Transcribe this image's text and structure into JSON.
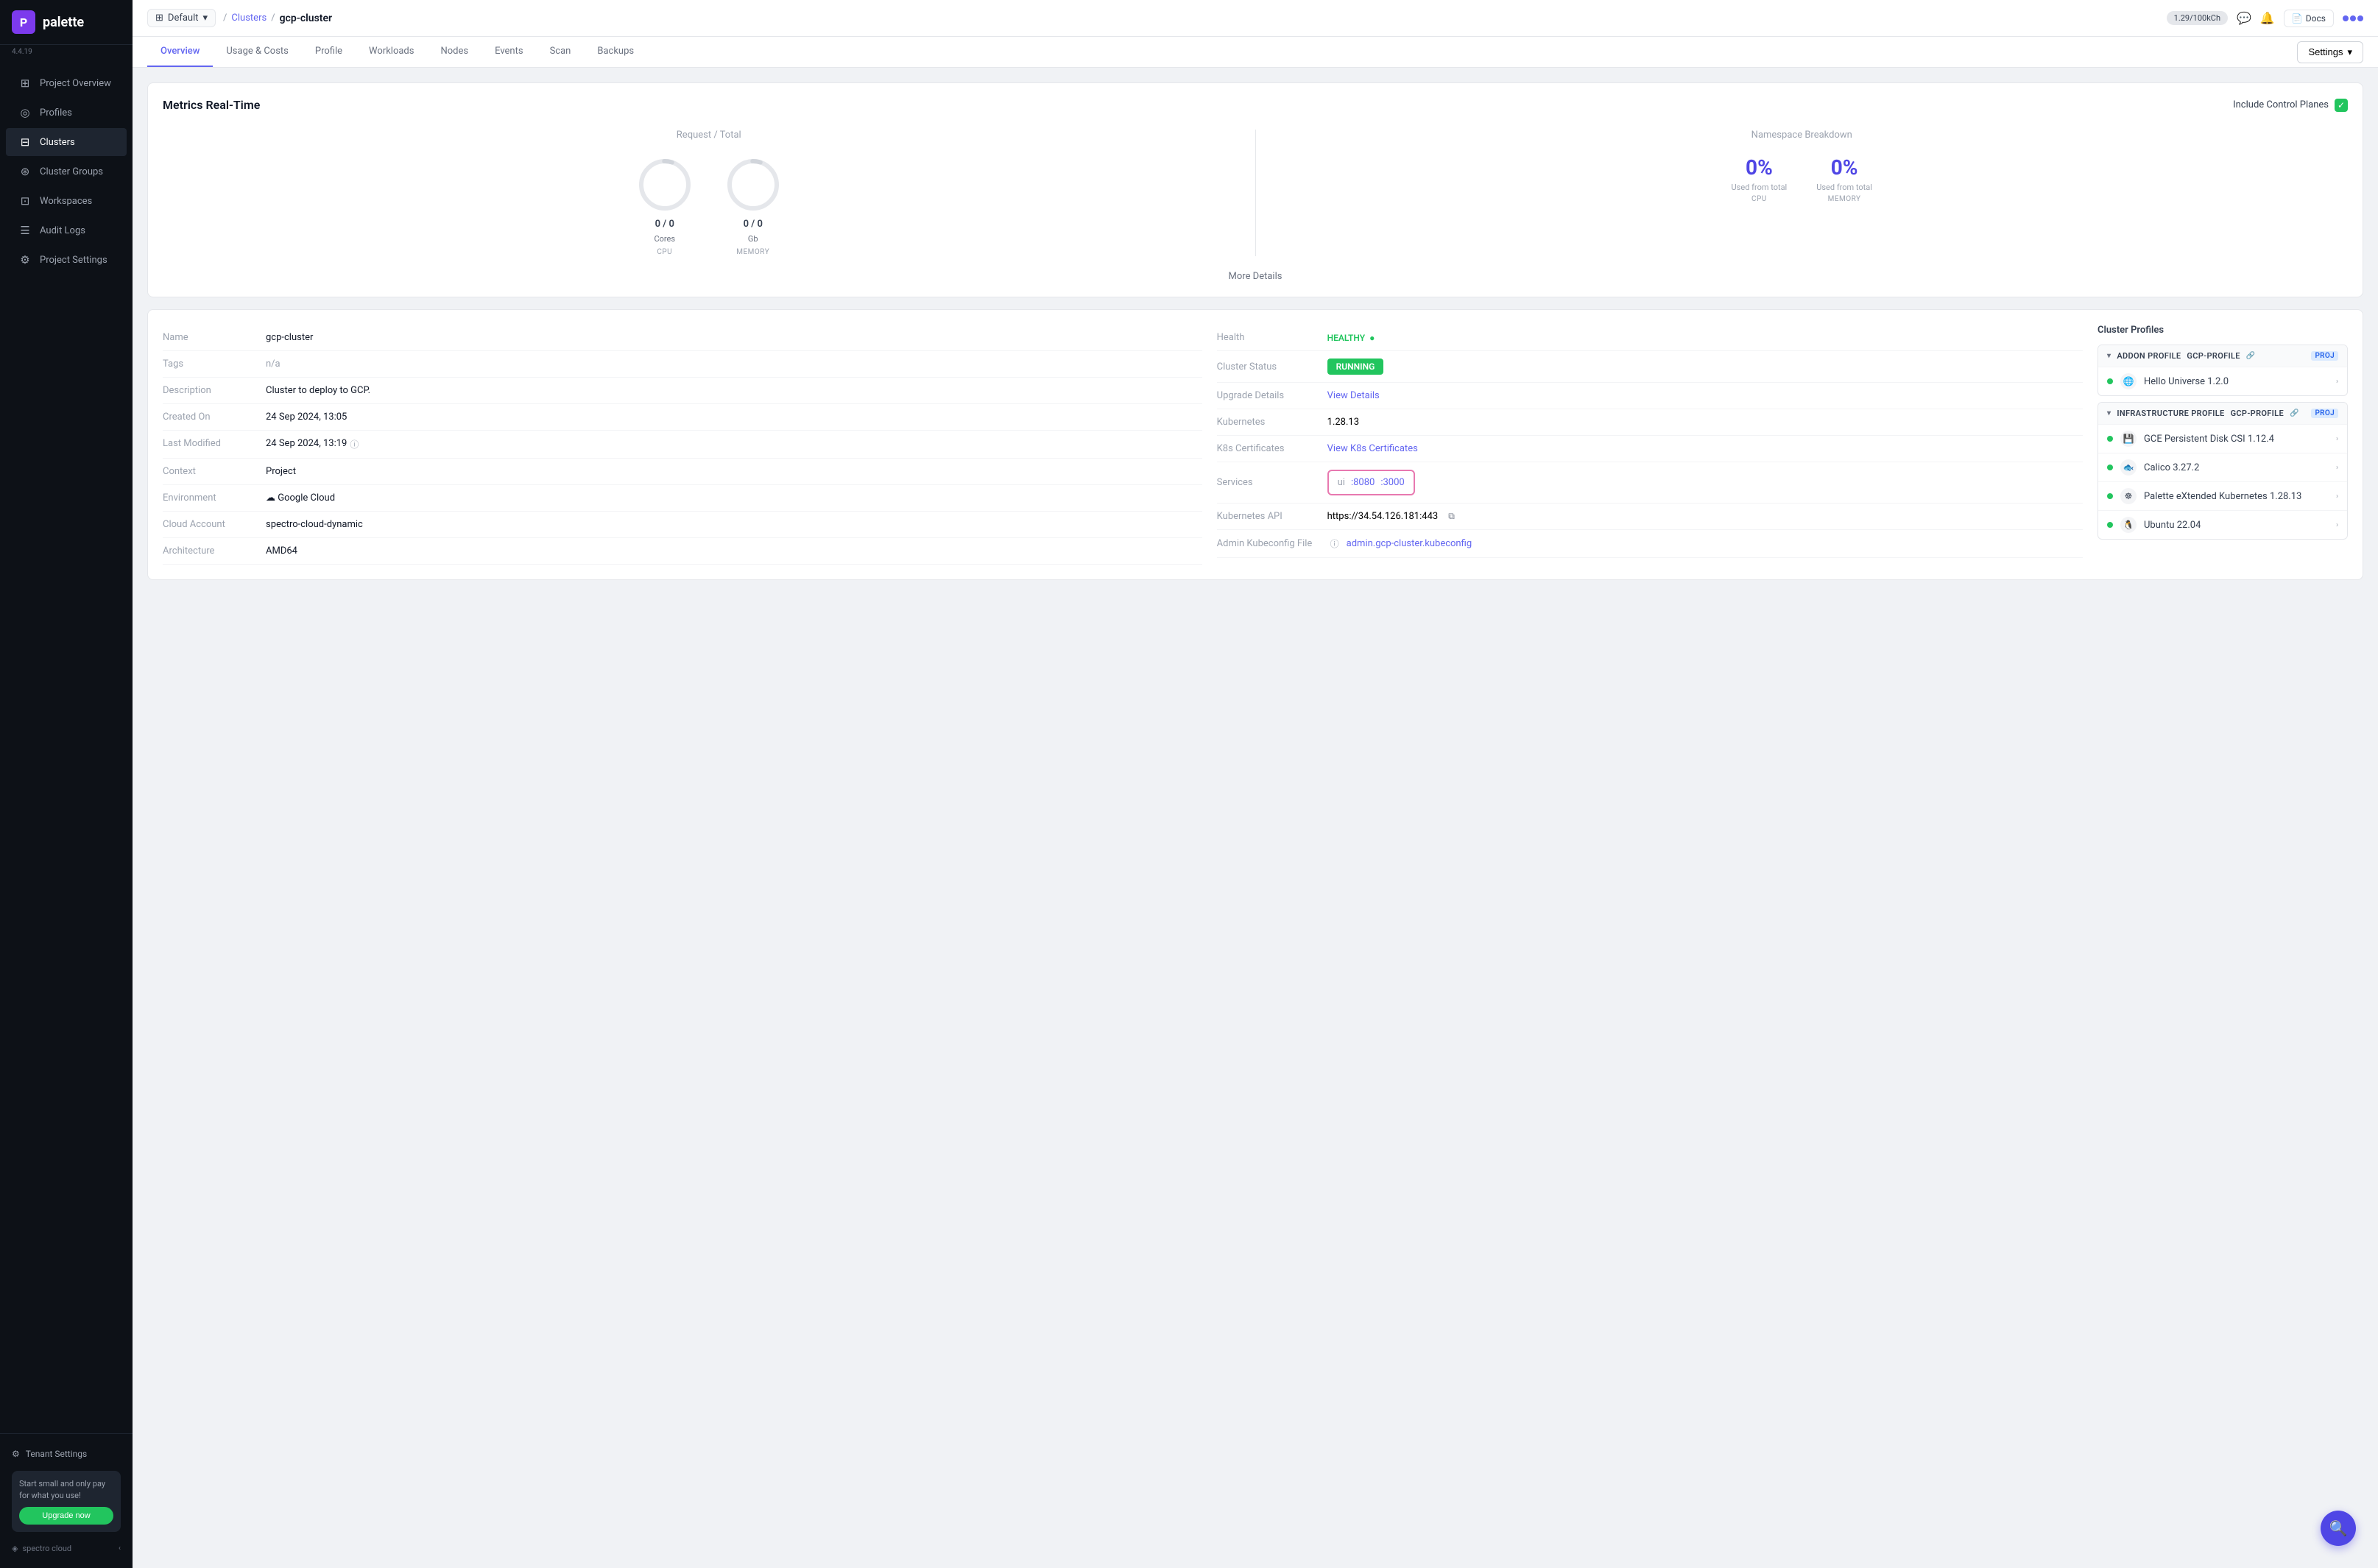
{
  "sidebar": {
    "logo": "palette",
    "version": "4.4.19",
    "items": [
      {
        "id": "project-overview",
        "label": "Project Overview",
        "icon": "⊞",
        "active": false
      },
      {
        "id": "profiles",
        "label": "Profiles",
        "icon": "◎",
        "active": false
      },
      {
        "id": "clusters",
        "label": "Clusters",
        "icon": "⊟",
        "active": true
      },
      {
        "id": "cluster-groups",
        "label": "Cluster Groups",
        "icon": "⊛",
        "active": false
      },
      {
        "id": "workspaces",
        "label": "Workspaces",
        "icon": "⊡",
        "active": false
      },
      {
        "id": "audit-logs",
        "label": "Audit Logs",
        "icon": "☰",
        "active": false
      },
      {
        "id": "project-settings",
        "label": "Project Settings",
        "icon": "⚙",
        "active": false
      }
    ],
    "tenant_settings": "Tenant Settings",
    "upgrade_text": "Start small and only pay for what you use!",
    "upgrade_btn": "Upgrade now",
    "spectro_cloud": "spectro cloud"
  },
  "topbar": {
    "workspace": "Default",
    "breadcrumb_clusters": "Clusters",
    "breadcrumb_cluster": "gcp-cluster",
    "kch": "1.29/100kCh",
    "docs": "Docs"
  },
  "tabs": {
    "items": [
      {
        "id": "overview",
        "label": "Overview",
        "active": true
      },
      {
        "id": "usage-costs",
        "label": "Usage & Costs",
        "active": false
      },
      {
        "id": "profile",
        "label": "Profile",
        "active": false
      },
      {
        "id": "workloads",
        "label": "Workloads",
        "active": false
      },
      {
        "id": "nodes",
        "label": "Nodes",
        "active": false
      },
      {
        "id": "events",
        "label": "Events",
        "active": false
      },
      {
        "id": "scan",
        "label": "Scan",
        "active": false
      },
      {
        "id": "backups",
        "label": "Backups",
        "active": false
      }
    ],
    "settings_btn": "Settings"
  },
  "metrics": {
    "title": "Metrics Real-Time",
    "include_control_planes": "Include Control Planes",
    "request_total_label": "Request / Total",
    "namespace_breakdown_label": "Namespace Breakdown",
    "cpu": {
      "value": "0",
      "total": "0",
      "unit": "Cores",
      "label": "CPU"
    },
    "memory": {
      "value": "0",
      "total": "0",
      "unit": "Gb",
      "label": "MEMORY"
    },
    "ns_cpu": {
      "pct": "0%",
      "desc": "Used from total",
      "label": "CPU"
    },
    "ns_memory": {
      "pct": "0%",
      "desc": "Used from total",
      "label": "MEMORY"
    },
    "more_details": "More Details"
  },
  "cluster_info": {
    "rows": [
      {
        "label": "Name",
        "value": "gcp-cluster"
      },
      {
        "label": "Tags",
        "value": "n/a",
        "muted": true
      },
      {
        "label": "Description",
        "value": "Cluster to deploy to GCP."
      },
      {
        "label": "Created On",
        "value": "24 Sep 2024, 13:05"
      },
      {
        "label": "Last Modified",
        "value": "24 Sep 2024, 13:19",
        "has_info": true
      },
      {
        "label": "Context",
        "value": "Project"
      },
      {
        "label": "Environment",
        "value": "Google Cloud",
        "has_icon": true
      },
      {
        "label": "Cloud Account",
        "value": "spectro-cloud-dynamic"
      },
      {
        "label": "Architecture",
        "value": "AMD64"
      }
    ]
  },
  "cluster_health": {
    "rows": [
      {
        "label": "Health",
        "type": "healthy",
        "value": "HEALTHY"
      },
      {
        "label": "Cluster Status",
        "type": "running",
        "value": "RUNNING"
      },
      {
        "label": "Upgrade Details",
        "type": "link",
        "value": "View Details"
      },
      {
        "label": "Kubernetes",
        "value": "1.28.13"
      },
      {
        "label": "K8s Certificates",
        "type": "link",
        "value": "View K8s Certificates"
      },
      {
        "label": "Services",
        "type": "services",
        "service_label": "ui",
        "port1": ":8080",
        "port2": ":3000"
      },
      {
        "label": "Kubernetes API",
        "type": "copy",
        "value": "https://34.54.126.181:443"
      },
      {
        "label": "Admin Kubeconfig File",
        "type": "link",
        "value": "admin.gcp-cluster.kubeconfig",
        "has_info": true
      }
    ]
  },
  "cluster_profiles": {
    "title": "Cluster Profiles",
    "groups": [
      {
        "type": "ADDON PROFILE",
        "name": "GCP-PROFILE",
        "badge": "PROJ",
        "items": [
          {
            "name": "Hello Universe 1.2.0",
            "icon": "🌐"
          }
        ]
      },
      {
        "type": "INFRASTRUCTURE PROFILE",
        "name": "GCP-PROFILE",
        "badge": "PROJ",
        "items": [
          {
            "name": "GCE Persistent Disk CSI 1.12.4",
            "icon": "💾"
          },
          {
            "name": "Calico 3.27.2",
            "icon": "🐟"
          },
          {
            "name": "Palette eXtended Kubernetes 1.28.13",
            "icon": "☸"
          },
          {
            "name": "Ubuntu 22.04",
            "icon": "🐧"
          }
        ]
      }
    ]
  }
}
